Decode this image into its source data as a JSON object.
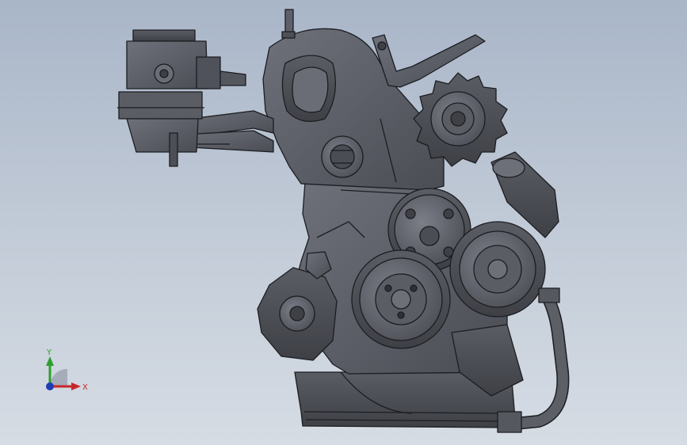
{
  "triad": {
    "x_label": "X",
    "y_label": "Y",
    "colors": {
      "x": "#c62828",
      "y": "#2e9e2e",
      "z": "#1f3cb4"
    }
  },
  "model": {
    "body_color": "#55585f",
    "edge_color": "#1c1d21",
    "highlight_color": "#7a7d85"
  },
  "background": {
    "top": "#a9b6c8",
    "bottom": "#d6dce4"
  }
}
